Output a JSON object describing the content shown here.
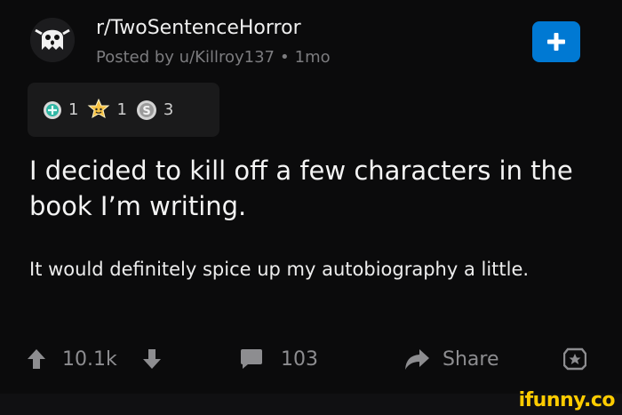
{
  "post": {
    "subreddit": "r/TwoSentenceHorror",
    "posted_by": "Posted by u/Killroy137",
    "separator": "•",
    "age": "1mo"
  },
  "awards": [
    {
      "icon": "helpful-award-icon",
      "count": "1"
    },
    {
      "icon": "wholesome-award-icon",
      "count": "1"
    },
    {
      "icon": "silver-award-icon",
      "count": "3"
    }
  ],
  "title": "I decided to kill off a few characters in the book I’m writing.",
  "body": "It would definitely spice up my autobiography a little.",
  "actions": {
    "upvote_icon": "arrow-up-icon",
    "score": "10.1k",
    "downvote_icon": "arrow-down-icon",
    "comment_icon": "comment-icon",
    "comments": "103",
    "share_icon": "share-icon",
    "share_label": "Share",
    "save_icon": "award-icon"
  },
  "watermark": "ifunny.co",
  "colors": {
    "background": "#0b0b0c",
    "accent": "#0079d3",
    "watermark": "#ffcc00"
  }
}
